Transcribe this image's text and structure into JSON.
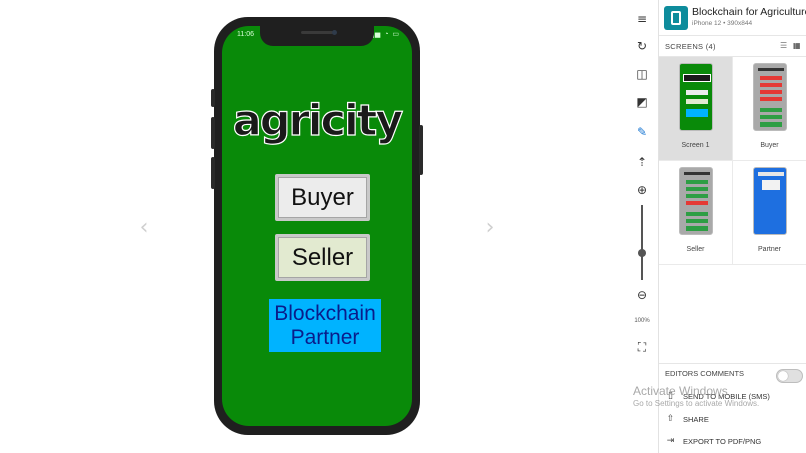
{
  "project": {
    "name": "Blockchain for Agriculture",
    "device": "iPhone 12 • 390x844"
  },
  "phone": {
    "status_time": "11:06",
    "status_icons": "▁▃▅ ◔ ▭",
    "app_title": "agricity",
    "buyer_label": "Buyer",
    "seller_label": "Seller",
    "partner_line1": "Blockchain",
    "partner_line2": "Partner"
  },
  "nav": {
    "prev": "‹",
    "next": "›"
  },
  "toolbar": {
    "menu": "≡",
    "refresh": "↻",
    "compare": "◫",
    "contrast": "◩",
    "edit": "✎",
    "upload": "⇡",
    "zoom_in": "⊕",
    "zoom_out": "⊖",
    "zoom_level": "100%",
    "fullscreen": "⛶"
  },
  "screens": {
    "header": "SCREENS (4)",
    "list_icon": "☰",
    "grid_icon": "▦",
    "items": [
      {
        "label": "Screen 1"
      },
      {
        "label": "Buyer"
      },
      {
        "label": "Seller"
      },
      {
        "label": "Partner"
      }
    ]
  },
  "comments": {
    "label": "EDITORS COMMENTS"
  },
  "actions": {
    "send_mobile": "SEND TO MOBILE (SMS)",
    "share": "SHARE",
    "export": "EXPORT TO PDF/PNG",
    "send_icon": "▯",
    "share_icon": "⇧",
    "export_icon": "⇥"
  },
  "watermark": {
    "line1": "Activate Windows",
    "line2": "Go to Settings to activate Windows."
  },
  "colors": {
    "app_green": "#098a09",
    "partner_blue": "#00b3ff",
    "brand_teal": "#0e8c9c"
  }
}
